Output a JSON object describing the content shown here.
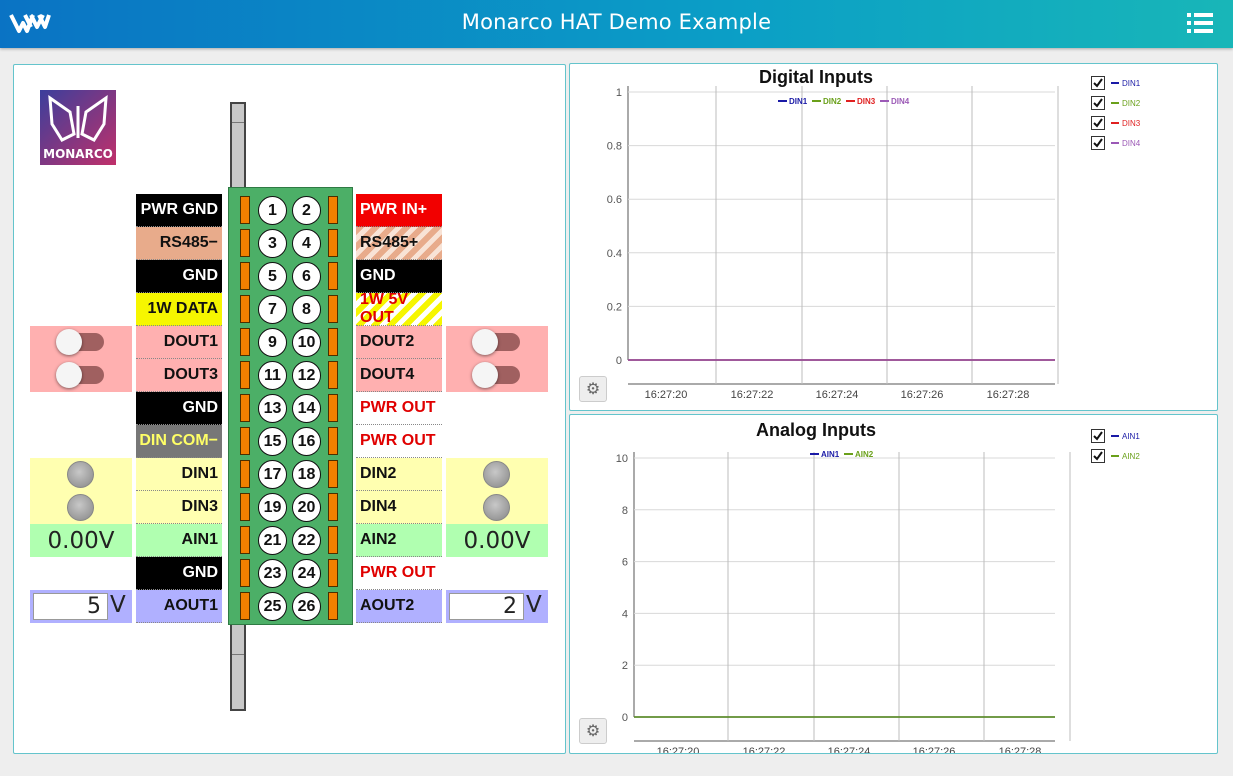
{
  "header": {
    "title": "Monarco HAT Demo Example",
    "logo_icon": "monarco-w-icon",
    "menu_icon": "list-menu-icon"
  },
  "brand": {
    "text": "MONARCO"
  },
  "pins": [
    {
      "left": "1",
      "right": "2"
    },
    {
      "left": "3",
      "right": "4"
    },
    {
      "left": "5",
      "right": "6"
    },
    {
      "left": "7",
      "right": "8"
    },
    {
      "left": "9",
      "right": "10"
    },
    {
      "left": "11",
      "right": "12"
    },
    {
      "left": "13",
      "right": "14"
    },
    {
      "left": "15",
      "right": "16"
    },
    {
      "left": "17",
      "right": "18"
    },
    {
      "left": "19",
      "right": "20"
    },
    {
      "left": "21",
      "right": "22"
    },
    {
      "left": "23",
      "right": "24"
    },
    {
      "left": "25",
      "right": "26"
    }
  ],
  "labels_left": [
    "PWR GND",
    "RS485−",
    "GND",
    "1W DATA",
    "DOUT1",
    "DOUT3",
    "GND",
    "DIN COM−",
    "DIN1",
    "DIN3",
    "AIN1",
    "GND",
    "AOUT1"
  ],
  "labels_right": [
    "PWR IN+",
    "RS485+",
    "GND",
    "1W 5V OUT",
    "DOUT2",
    "DOUT4",
    "PWR OUT",
    "PWR OUT",
    "DIN2",
    "DIN4",
    "AIN2",
    "PWR OUT",
    "AOUT2"
  ],
  "outputs": {
    "dout1": false,
    "dout2": false,
    "dout3": false,
    "dout4": false
  },
  "inputs": {
    "din1": false,
    "din2": false,
    "din3": false,
    "din4": false
  },
  "analog": {
    "ain1": "0.00V",
    "ain2": "0.00V",
    "aout1_value": "5",
    "aout2_value": "2",
    "unit": "V"
  },
  "colors": {
    "accent": "#0b9fc6",
    "din1": "#1a1aa6",
    "din2": "#6aa01a",
    "din3": "#e02020",
    "din4": "#9b59b6",
    "ain1": "#1a1aa6",
    "ain2": "#6aa01a"
  },
  "chart_data": [
    {
      "type": "line",
      "title": "Digital Inputs",
      "x": [
        "16:27:20",
        "16:27:22",
        "16:27:24",
        "16:27:26",
        "16:27:28"
      ],
      "yticks": [
        "0",
        "0.2",
        "0.4",
        "0.6",
        "0.8",
        "1"
      ],
      "ylim": [
        0,
        1
      ],
      "grid": true,
      "legend_placement": "top",
      "series": [
        {
          "name": "DIN1",
          "values": [
            0,
            0,
            0,
            0,
            0
          ],
          "checked": true
        },
        {
          "name": "DIN2",
          "values": [
            0,
            0,
            0,
            0,
            0
          ],
          "checked": true
        },
        {
          "name": "DIN3",
          "values": [
            0,
            0,
            0,
            0,
            0
          ],
          "checked": true
        },
        {
          "name": "DIN4",
          "values": [
            0,
            0,
            0,
            0,
            0
          ],
          "checked": true
        }
      ]
    },
    {
      "type": "line",
      "title": "Analog Inputs",
      "x": [
        "16:27:20",
        "16:27:22",
        "16:27:24",
        "16:27:26",
        "16:27:28"
      ],
      "yticks": [
        "0",
        "2",
        "4",
        "6",
        "8",
        "10"
      ],
      "ylim": [
        0,
        10
      ],
      "grid": true,
      "legend_placement": "top",
      "series": [
        {
          "name": "AIN1",
          "values": [
            0,
            0,
            0,
            0,
            0
          ],
          "checked": true
        },
        {
          "name": "AIN2",
          "values": [
            0,
            0,
            0,
            0,
            0
          ],
          "checked": true
        }
      ]
    }
  ]
}
